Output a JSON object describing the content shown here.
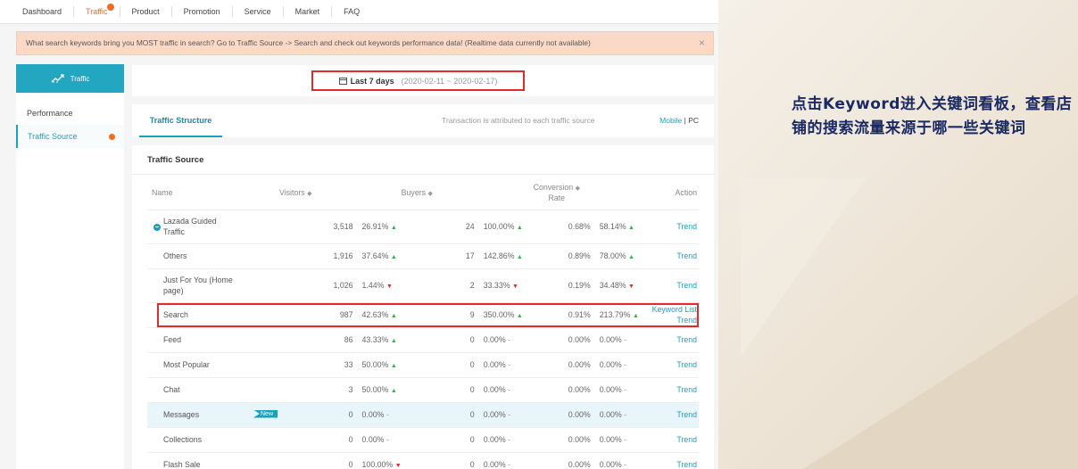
{
  "nav": {
    "items": [
      {
        "label": "Dashboard",
        "active": false
      },
      {
        "label": "Traffic",
        "active": true
      },
      {
        "label": "Product",
        "active": false
      },
      {
        "label": "Promotion",
        "active": false
      },
      {
        "label": "Service",
        "active": false
      },
      {
        "label": "Market",
        "active": false
      },
      {
        "label": "FAQ",
        "active": false
      }
    ]
  },
  "banner": {
    "text": "What search keywords bring you MOST traffic in search? Go to Traffic Source -> Search and check out keywords performance data! (Realtime data currently not available)",
    "close": "×"
  },
  "sidebar": {
    "title": "Traffic",
    "icon": "chart-icon",
    "items": [
      {
        "label": "Performance",
        "active": false
      },
      {
        "label": "Traffic Source",
        "active": true
      }
    ]
  },
  "date": {
    "label": "Last 7 days",
    "range": "(2020-02-11 ~ 2020-02-17)",
    "icon": "calendar-icon"
  },
  "tabs": {
    "structure": "Traffic Structure",
    "note": "Transaction is attributed to each traffic source",
    "mobile": "Mobile",
    "separator": "|",
    "pc": "PC"
  },
  "source": {
    "title": "Traffic Source",
    "headers": {
      "name": "Name",
      "visitors": "Visitors",
      "buyers": "Buyers",
      "conversion1": "Conversion",
      "conversion2": "Rate",
      "action": "Action"
    },
    "rows": [
      {
        "name": "Lazada Guided Traffic",
        "visitors": "3,518",
        "v_pct": "26.91%",
        "v_dir": "up",
        "buyers": "24",
        "b_pct": "100.00%",
        "b_dir": "up",
        "conv": "0.68%",
        "c_pct": "58.14%",
        "c_dir": "up",
        "action": "Trend"
      },
      {
        "name": "Others",
        "visitors": "1,916",
        "v_pct": "37.64%",
        "v_dir": "up",
        "buyers": "17",
        "b_pct": "142.86%",
        "b_dir": "up",
        "conv": "0.89%",
        "c_pct": "78.00%",
        "c_dir": "up",
        "action": "Trend"
      },
      {
        "name": "Just For You (Home page)",
        "visitors": "1,026",
        "v_pct": "1.44%",
        "v_dir": "down",
        "buyers": "2",
        "b_pct": "33.33%",
        "b_dir": "down",
        "conv": "0.19%",
        "c_pct": "34.48%",
        "c_dir": "down",
        "action": "Trend"
      },
      {
        "name": "Search",
        "visitors": "987",
        "v_pct": "42.63%",
        "v_dir": "up",
        "buyers": "9",
        "b_pct": "350.00%",
        "b_dir": "up",
        "conv": "0.91%",
        "c_pct": "213.79%",
        "c_dir": "up",
        "action": "Keyword List",
        "action2": "Trend"
      },
      {
        "name": "Feed",
        "visitors": "86",
        "v_pct": "43.33%",
        "v_dir": "up",
        "buyers": "0",
        "b_pct": "0.00%",
        "b_dir": "flat",
        "conv": "0.00%",
        "c_pct": "0.00%",
        "c_dir": "flat",
        "action": "Trend"
      },
      {
        "name": "Most Popular",
        "visitors": "33",
        "v_pct": "50.00%",
        "v_dir": "up",
        "buyers": "0",
        "b_pct": "0.00%",
        "b_dir": "flat",
        "conv": "0.00%",
        "c_pct": "0.00%",
        "c_dir": "flat",
        "action": "Trend"
      },
      {
        "name": "Chat",
        "visitors": "3",
        "v_pct": "50.00%",
        "v_dir": "up",
        "buyers": "0",
        "b_pct": "0.00%",
        "b_dir": "flat",
        "conv": "0.00%",
        "c_pct": "0.00%",
        "c_dir": "flat",
        "action": "Trend"
      },
      {
        "name": "Messages",
        "badge": "New",
        "visitors": "0",
        "v_pct": "0.00%",
        "v_dir": "flat",
        "buyers": "0",
        "b_pct": "0.00%",
        "b_dir": "flat",
        "conv": "0.00%",
        "c_pct": "0.00%",
        "c_dir": "flat",
        "action": "Trend"
      },
      {
        "name": "Collections",
        "visitors": "0",
        "v_pct": "0.00%",
        "v_dir": "flat",
        "buyers": "0",
        "b_pct": "0.00%",
        "b_dir": "flat",
        "conv": "0.00%",
        "c_pct": "0.00%",
        "c_dir": "flat",
        "action": "Trend"
      },
      {
        "name": "Flash Sale",
        "visitors": "0",
        "v_pct": "100.00%",
        "v_dir": "down",
        "buyers": "0",
        "b_pct": "0.00%",
        "b_dir": "flat",
        "conv": "0.00%",
        "c_pct": "0.00%",
        "c_dir": "flat",
        "action": "Trend"
      }
    ]
  },
  "annotation": "点击Keyword进入关键词看板，查看店铺的搜索流量来源于哪一些关键词",
  "colors": {
    "accent": "#1aa1bb",
    "orange": "#f06c22",
    "red_box": "#e32b2b",
    "up": "#2fb54a",
    "down": "#e32b2b"
  }
}
